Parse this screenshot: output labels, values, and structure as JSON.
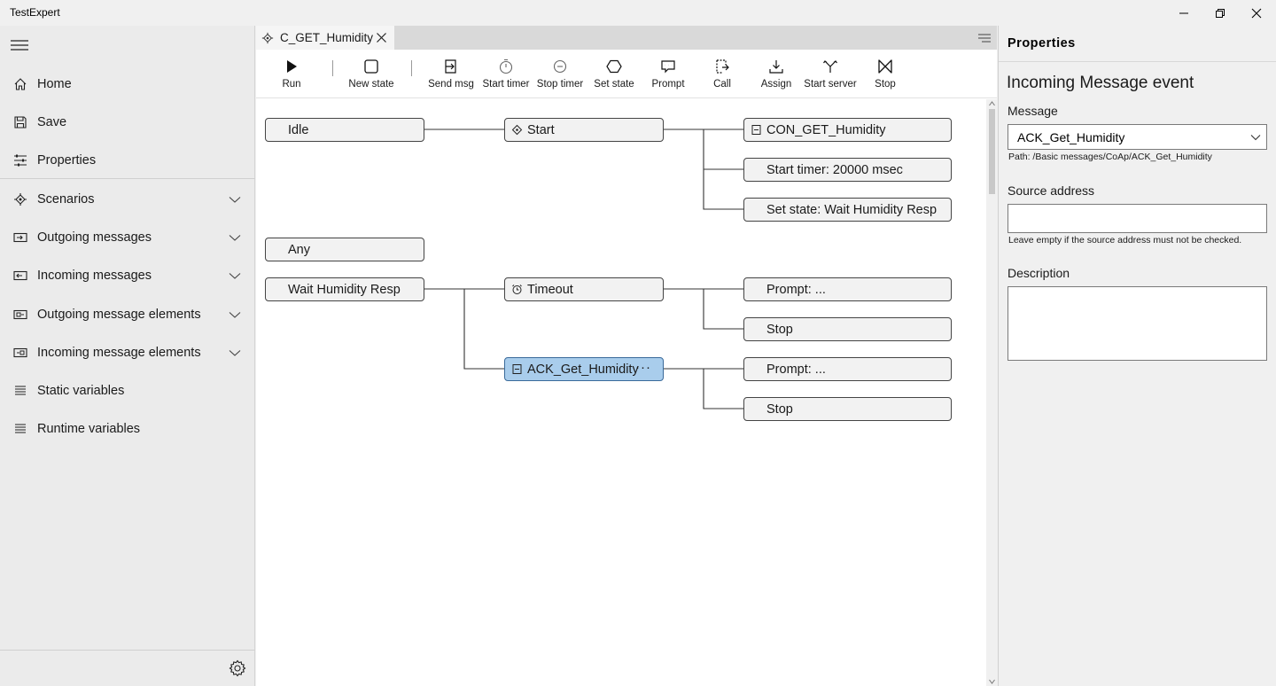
{
  "window": {
    "title": "TestExpert",
    "minimize_icon": "minimize-icon",
    "restore_icon": "restore-icon",
    "close_icon": "close-icon"
  },
  "sidebar": {
    "menu_icon": "hamburger-icon",
    "items": [
      {
        "label": "Home",
        "icon": "home-icon",
        "expandable": false
      },
      {
        "label": "Save",
        "icon": "save-icon",
        "expandable": false
      },
      {
        "label": "Properties",
        "icon": "properties-icon",
        "expandable": false
      },
      {
        "label": "Scenarios",
        "icon": "scenario-icon",
        "expandable": true
      },
      {
        "label": "Outgoing messages",
        "icon": "message-icon",
        "expandable": true
      },
      {
        "label": "Incoming messages",
        "icon": "message-icon",
        "expandable": true
      },
      {
        "label": "Outgoing message elements",
        "icon": "message-element-icon",
        "expandable": true
      },
      {
        "label": "Incoming message elements",
        "icon": "message-element-icon",
        "expandable": true
      },
      {
        "label": "Static variables",
        "icon": "list-icon",
        "expandable": false
      },
      {
        "label": "Runtime variables",
        "icon": "list-icon",
        "expandable": false
      }
    ],
    "settings_icon": "gear-icon"
  },
  "editor": {
    "tab": {
      "label": "C_GET_Humidity",
      "icon": "scenario-icon",
      "close_icon": "close-icon"
    },
    "toolbar": [
      {
        "label": "Run",
        "icon": "play-icon"
      },
      {
        "label": "New state",
        "icon": "square-icon"
      },
      {
        "label": "Send msg",
        "icon": "send-message-icon"
      },
      {
        "label": "Start timer",
        "icon": "stopwatch-icon"
      },
      {
        "label": "Stop timer",
        "icon": "stop-timer-icon"
      },
      {
        "label": "Set state",
        "icon": "hexagon-icon"
      },
      {
        "label": "Prompt",
        "icon": "prompt-icon"
      },
      {
        "label": "Call",
        "icon": "call-icon"
      },
      {
        "label": "Assign",
        "icon": "assign-icon"
      },
      {
        "label": "Start server",
        "icon": "start-server-icon"
      },
      {
        "label": "Stop",
        "icon": "stop-icon"
      }
    ],
    "nodes": [
      {
        "id": "idle",
        "label": "Idle",
        "icon": ""
      },
      {
        "id": "start",
        "label": "Start",
        "icon": "start-event-icon"
      },
      {
        "id": "con_get",
        "label": "CON_GET_Humidity",
        "icon": "message-action-icon"
      },
      {
        "id": "start_timer",
        "label": "Start timer: 20000 msec",
        "icon": ""
      },
      {
        "id": "set_state",
        "label": "Set state: Wait Humidity Resp",
        "icon": ""
      },
      {
        "id": "any",
        "label": "Any",
        "icon": ""
      },
      {
        "id": "wait",
        "label": "Wait Humidity Resp",
        "icon": ""
      },
      {
        "id": "timeout",
        "label": "Timeout",
        "icon": "alarm-clock-icon"
      },
      {
        "id": "prompt1",
        "label": "Prompt: ...",
        "icon": ""
      },
      {
        "id": "stop1",
        "label": "Stop",
        "icon": ""
      },
      {
        "id": "ack",
        "label": "ACK_Get_Humidity",
        "icon": "message-event-icon",
        "selected": true,
        "more": "···"
      },
      {
        "id": "prompt2",
        "label": "Prompt: ...",
        "icon": ""
      },
      {
        "id": "stop2",
        "label": "Stop",
        "icon": ""
      }
    ]
  },
  "properties": {
    "title": "Properties",
    "heading": "Incoming Message event",
    "message_label": "Message",
    "message_value": "ACK_Get_Humidity",
    "message_path": "Path: /Basic messages/CoAp/ACK_Get_Humidity",
    "source_label": "Source address",
    "source_value": "",
    "source_hint": "Leave empty if the source address must not be checked.",
    "description_label": "Description",
    "description_value": ""
  }
}
